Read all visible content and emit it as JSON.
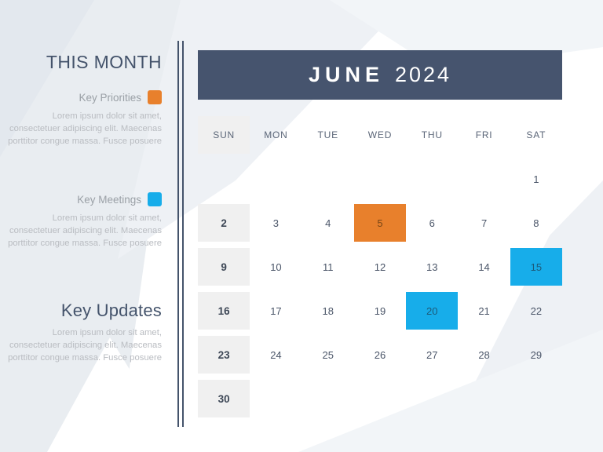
{
  "sidebar": {
    "heading": "THIS MONTH",
    "sections": [
      {
        "label": "Key Priorities",
        "swatch_color": "#e8802c",
        "swatch_name": "orange-legend-swatch",
        "body": "Lorem ipsum dolor sit amet, consectetuer adipiscing elit. Maecenas porttitor congue massa. Fusce posuere"
      },
      {
        "label": "Key Meetings",
        "swatch_color": "#17adea",
        "swatch_name": "blue-legend-swatch",
        "body": "Lorem ipsum dolor sit amet, consectetuer adipiscing elit. Maecenas porttitor congue massa. Fusce posuere"
      }
    ],
    "updates": {
      "title": "Key Updates",
      "body": "Lorem ipsum dolor sit amet, consectetuer adipiscing elit. Maecenas porttitor congue massa. Fusce posuere"
    }
  },
  "calendar": {
    "month": "JUNE",
    "year": "2024",
    "header_bg": "#46546e",
    "weekday_headers": [
      "SUN",
      "MON",
      "TUE",
      "WED",
      "THU",
      "FRI",
      "SAT"
    ],
    "sunday_column_bg": "#f0f0f0",
    "highlight_orange": "#e8802c",
    "highlight_blue": "#17adea",
    "weeks": [
      [
        {
          "day": "",
          "type": "empty"
        },
        {
          "day": "",
          "type": "empty"
        },
        {
          "day": "",
          "type": "empty"
        },
        {
          "day": "",
          "type": "empty"
        },
        {
          "day": "",
          "type": "empty"
        },
        {
          "day": "",
          "type": "empty"
        },
        {
          "day": "1",
          "type": "normal"
        }
      ],
      [
        {
          "day": "2",
          "type": "sunday"
        },
        {
          "day": "3",
          "type": "normal"
        },
        {
          "day": "4",
          "type": "normal"
        },
        {
          "day": "5",
          "type": "orange"
        },
        {
          "day": "6",
          "type": "normal"
        },
        {
          "day": "7",
          "type": "normal"
        },
        {
          "day": "8",
          "type": "normal"
        }
      ],
      [
        {
          "day": "9",
          "type": "sunday"
        },
        {
          "day": "10",
          "type": "normal"
        },
        {
          "day": "11",
          "type": "normal"
        },
        {
          "day": "12",
          "type": "normal"
        },
        {
          "day": "13",
          "type": "normal"
        },
        {
          "day": "14",
          "type": "normal"
        },
        {
          "day": "15",
          "type": "blue"
        }
      ],
      [
        {
          "day": "16",
          "type": "sunday"
        },
        {
          "day": "17",
          "type": "normal"
        },
        {
          "day": "18",
          "type": "normal"
        },
        {
          "day": "19",
          "type": "normal"
        },
        {
          "day": "20",
          "type": "blue"
        },
        {
          "day": "21",
          "type": "normal"
        },
        {
          "day": "22",
          "type": "normal"
        }
      ],
      [
        {
          "day": "23",
          "type": "sunday"
        },
        {
          "day": "24",
          "type": "normal"
        },
        {
          "day": "25",
          "type": "normal"
        },
        {
          "day": "26",
          "type": "normal"
        },
        {
          "day": "27",
          "type": "normal"
        },
        {
          "day": "28",
          "type": "normal"
        },
        {
          "day": "29",
          "type": "normal"
        }
      ],
      [
        {
          "day": "30",
          "type": "sunday"
        },
        {
          "day": "",
          "type": "empty"
        },
        {
          "day": "",
          "type": "empty"
        },
        {
          "day": "",
          "type": "empty"
        },
        {
          "day": "",
          "type": "empty"
        },
        {
          "day": "",
          "type": "empty"
        },
        {
          "day": "",
          "type": "empty"
        }
      ]
    ]
  }
}
